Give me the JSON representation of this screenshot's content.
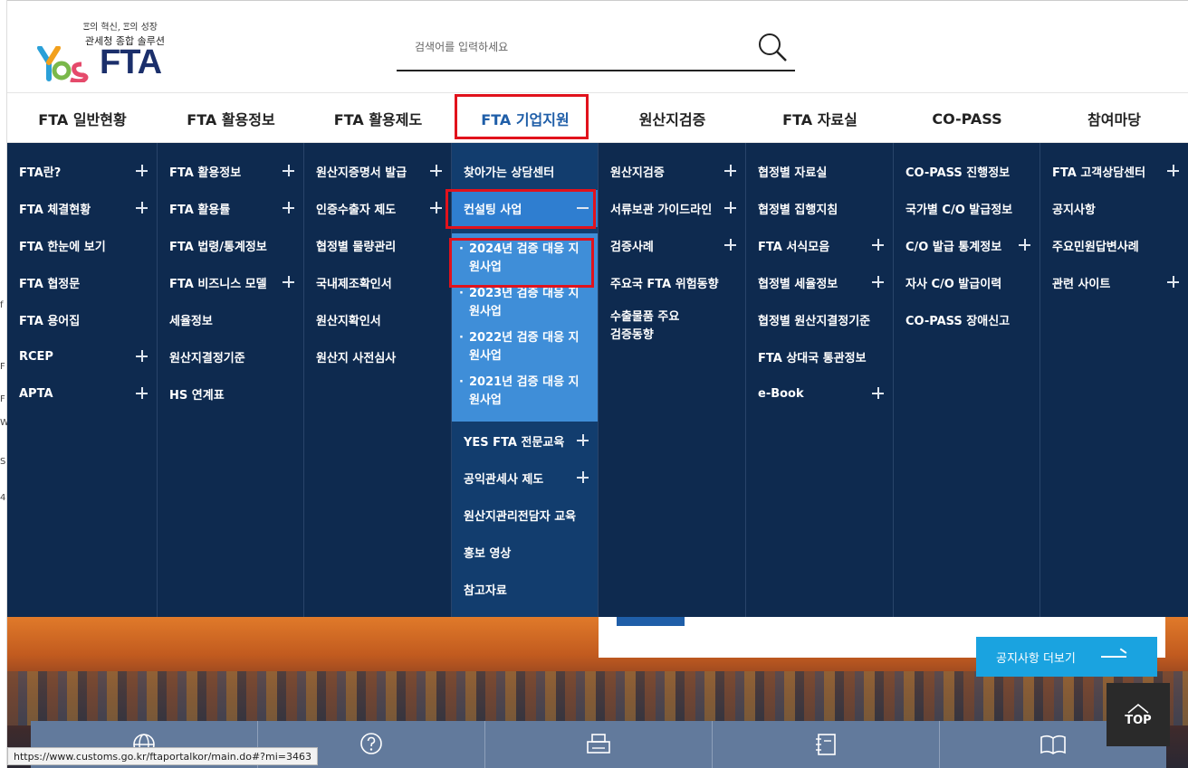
{
  "logo": {
    "slogan": "Ξ의 혁신, Ξ의 성장",
    "subtitle": "관세청 종합 솔루션",
    "brand_mark": "Yes",
    "brand_text": "FTA"
  },
  "search": {
    "placeholder": "검색어를 입력하세요"
  },
  "gnb": {
    "tabs": [
      "FTA 일반현황",
      "FTA 활용정보",
      "FTA 활용제도",
      "FTA 기업지원",
      "원산지검증",
      "FTA 자료실",
      "CO-PASS",
      "참여마당"
    ],
    "active_index": 3
  },
  "menu": {
    "col1": [
      "FTA란?",
      "FTA 체결현황",
      "FTA 한눈에 보기",
      "FTA 협정문",
      "FTA 용어집",
      "RCEP",
      "APTA"
    ],
    "col2": [
      "FTA 활용정보",
      "FTA 활용률",
      "FTA 법령/통계정보",
      "FTA 비즈니스 모델",
      "세율정보",
      "원산지결정기준",
      "HS 연계표"
    ],
    "col3": [
      "원산지증명서 발급",
      "인증수출자 제도",
      "협정별 물량관리",
      "국내제조확인서",
      "원산지확인서",
      "원산지 사전심사"
    ],
    "col4": {
      "top": [
        "찾아가는 상담센터",
        "컨설팅 사업"
      ],
      "sub": [
        "2024년 검증 대응 지원사업",
        "2023년 검증 대응 지원사업",
        "2022년 검증 대응 지원사업",
        "2021년 검증 대응 지원사업"
      ],
      "bottom": [
        "YES FTA 전문교육",
        "공익관세사 제도",
        "원산지관리전담자 교육",
        "홍보 영상",
        "참고자료"
      ]
    },
    "col5": [
      "원산지검증",
      "서류보관 가이드라인",
      "검증사례",
      "주요국 FTA 위험동향",
      "수출물품 주요 검증동향"
    ],
    "col6": [
      "협정별 자료실",
      "협정별 집행지침",
      "FTA 서식모음",
      "협정별 세율정보",
      "협정별 원산지결정기준",
      "FTA 상대국 통관정보",
      "e-Book"
    ],
    "col7": [
      "CO-PASS 진행정보",
      "국가별 C/O 발급정보",
      "C/O 발급 통계정보",
      "자사 C/O 발급이력",
      "CO-PASS 장애신고"
    ],
    "col8": [
      "FTA 고객상담센터",
      "공지사항",
      "주요민원답변사례",
      "관련 사이트"
    ]
  },
  "notice_button": "공지사항 더보기",
  "top_button": "TOP",
  "status_url": "https://www.customs.go.kr/ftaportalkor/main.do#?mi=3463",
  "left_strip": [
    "f",
    "F",
    "F",
    "W",
    "S",
    "4"
  ],
  "colors": {
    "navy": "#0e2a4f",
    "active_blue": "#1f5ea8",
    "sub_blue": "#3f8ed8",
    "highlight_red": "#e1121c",
    "notice_btn": "#1aa3e0"
  }
}
